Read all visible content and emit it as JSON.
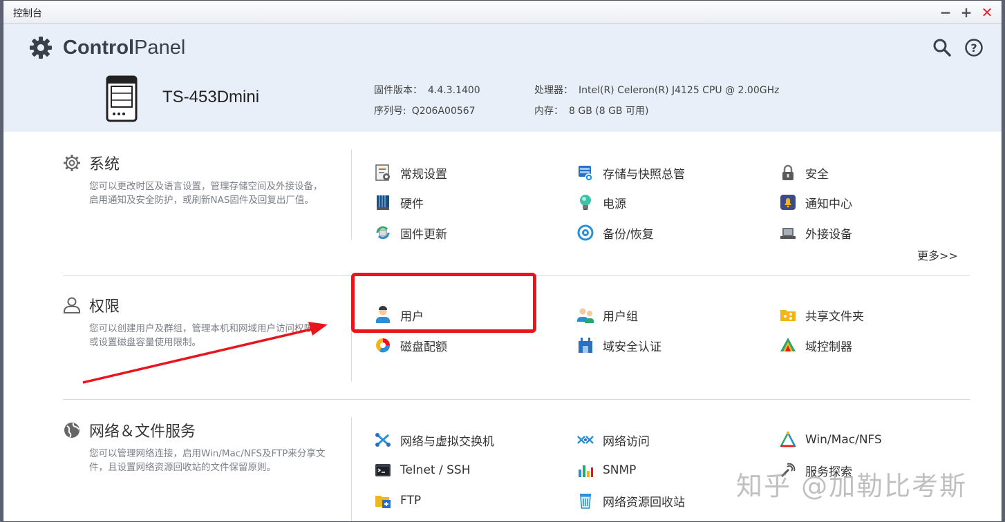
{
  "window": {
    "title": "控制台"
  },
  "header": {
    "app_title_bold": "Control",
    "app_title_light": "Panel",
    "model": "TS-453Dmini",
    "firmware_label": "固件版本：",
    "firmware_value": "4.4.3.1400",
    "serial_label": "序列号:",
    "serial_value": "Q206A00567",
    "cpu_label": "处理器：",
    "cpu_value": "Intel(R) Celeron(R) J4125 CPU @ 2.00GHz",
    "memory_label": "内存：",
    "memory_value": "8 GB (8 GB 可用)"
  },
  "sections": {
    "system": {
      "title": "系统",
      "desc": "您可以更改时区及语言设置，管理存储空间及外接设备，启用通知及安全防护，或刷新NAS固件及回复出厂值。",
      "items": [
        "常规设置",
        "存储与快照总管",
        "安全",
        "硬件",
        "电源",
        "通知中心",
        "固件更新",
        "备份/恢复",
        "外接设备"
      ],
      "more": "更多>>"
    },
    "privilege": {
      "title": "权限",
      "desc": "您可以创建用户及群组，管理本机和网域用户访问权限，或设置磁盘容量使用限制。",
      "items": [
        "用户",
        "用户组",
        "共享文件夹",
        "磁盘配额",
        "域安全认证",
        "域控制器"
      ]
    },
    "network": {
      "title": "网络＆文件服务",
      "desc": "您可以管理网络连接，启用Win/Mac/NFS及FTP来分享文件，且设置网络资源回收站的文件保留原则。",
      "items": [
        "网络与虚拟交换机",
        "网络访问",
        "Win/Mac/NFS",
        "Telnet / SSH",
        "SNMP",
        "服务探索",
        "FTP",
        "网络资源回收站"
      ]
    }
  },
  "watermark": "知乎 @加勒比考斯",
  "colors": {
    "header_bg": "#e9eff9",
    "highlight_red": "#e8161c",
    "accent_blue": "#2a8fd6"
  }
}
